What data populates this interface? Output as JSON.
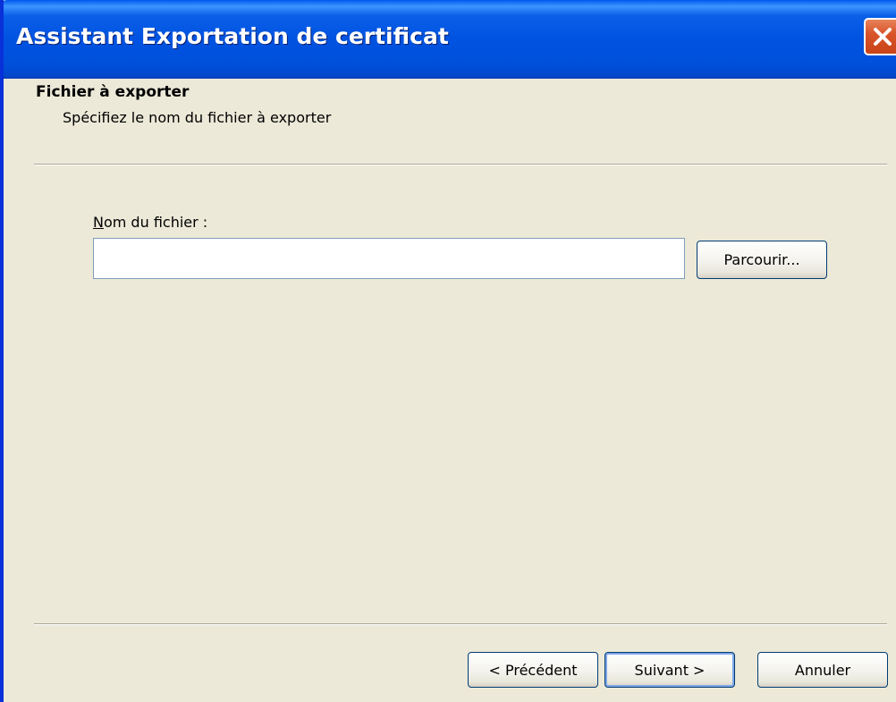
{
  "window": {
    "title": "Assistant Exportation de certificat"
  },
  "icons": {
    "close": "close-icon"
  },
  "header": {
    "title": "Fichier à exporter",
    "subtitle": "Spécifiez le nom du fichier à exporter"
  },
  "form": {
    "file_label_accel": "N",
    "file_label_rest": "om du fichier :",
    "file_value": "",
    "browse_label": "Parcourir..."
  },
  "buttons": {
    "prev_label": "< Précédent",
    "next_label": "Suivant >",
    "cancel_label": "Annuler"
  },
  "colors": {
    "titlebar": "#0053e0",
    "face": "#ece9d8",
    "close": "#d9542a"
  }
}
